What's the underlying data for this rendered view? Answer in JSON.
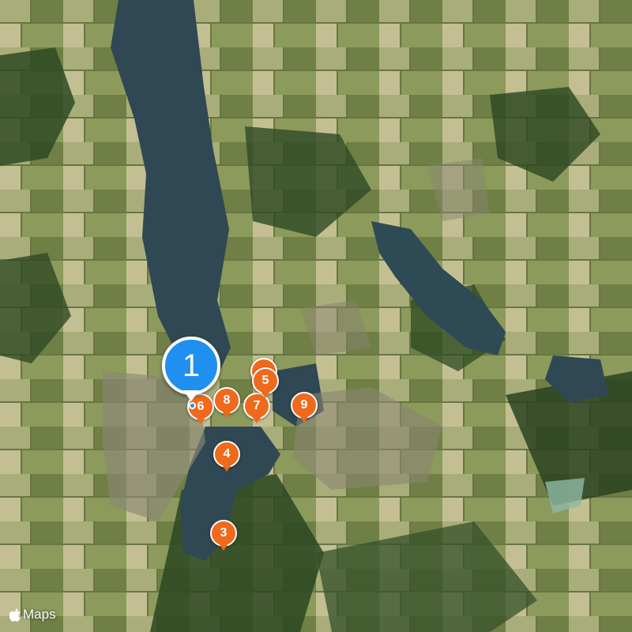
{
  "map": {
    "markers": [
      {
        "label": "1",
        "style": "primary",
        "color": "#1f8ff0"
      },
      {
        "label": "6",
        "style": "secondary",
        "color": "#ef6a1c"
      },
      {
        "label": "8",
        "style": "secondary",
        "color": "#ef6a1c"
      },
      {
        "label": "7",
        "style": "secondary",
        "color": "#ef6a1c"
      },
      {
        "label": "5",
        "style": "secondary",
        "color": "#ef6a1c"
      },
      {
        "label": "9",
        "style": "secondary",
        "color": "#ef6a1c"
      },
      {
        "label": "4",
        "style": "secondary",
        "color": "#ef6a1c"
      },
      {
        "label": "3",
        "style": "secondary",
        "color": "#ef6a1c"
      }
    ],
    "user_location_icon": "location-dot-icon"
  },
  "attribution": {
    "logo_icon": "apple-logo-icon",
    "text": "Maps"
  }
}
